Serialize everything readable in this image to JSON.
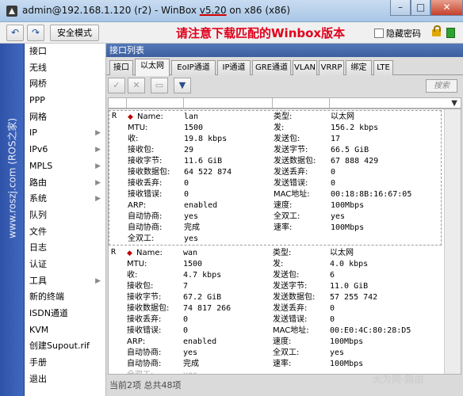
{
  "window": {
    "title_prefix": "admin@192.168.1.120 (r2) - WinBox ",
    "title_version": "v5.20",
    "title_suffix": " on x86 (x86)",
    "min_glyph": "–",
    "max_glyph": "□",
    "close_glyph": "✕"
  },
  "toolbar": {
    "undo_glyph": "↶",
    "redo_glyph": "↷",
    "safe_mode_label": "安全模式",
    "notice": "请注意下载匹配的Winbox版本",
    "hide_passwords_label": "隐藏密码"
  },
  "sidebar": {
    "brand": "www.roszj.com (ROS之家)",
    "items": [
      {
        "label": "接口",
        "arrow": ""
      },
      {
        "label": "无线",
        "arrow": ""
      },
      {
        "label": "网桥",
        "arrow": ""
      },
      {
        "label": "PPP",
        "arrow": ""
      },
      {
        "label": "网格",
        "arrow": ""
      },
      {
        "label": "IP",
        "arrow": "▶"
      },
      {
        "label": "IPv6",
        "arrow": "▶"
      },
      {
        "label": "MPLS",
        "arrow": "▶"
      },
      {
        "label": "路由",
        "arrow": "▶"
      },
      {
        "label": "系统",
        "arrow": "▶"
      },
      {
        "label": "队列",
        "arrow": ""
      },
      {
        "label": "文件",
        "arrow": ""
      },
      {
        "label": "日志",
        "arrow": ""
      },
      {
        "label": "认证",
        "arrow": ""
      },
      {
        "label": "工具",
        "arrow": "▶"
      },
      {
        "label": "新的终端",
        "arrow": ""
      },
      {
        "label": "ISDN通道",
        "arrow": ""
      },
      {
        "label": "KVM",
        "arrow": ""
      },
      {
        "label": "创建Supout.rif",
        "arrow": ""
      },
      {
        "label": "手册",
        "arrow": ""
      },
      {
        "label": "退出",
        "arrow": ""
      }
    ]
  },
  "panel": {
    "title": "接口列表",
    "tabs": [
      {
        "label": "接口"
      },
      {
        "label": "以太网"
      },
      {
        "label": "EoIP通道"
      },
      {
        "label": "IP通道"
      },
      {
        "label": "GRE通道"
      },
      {
        "label": "VLAN"
      },
      {
        "label": "VRRP"
      },
      {
        "label": "绑定"
      },
      {
        "label": "LTE"
      }
    ],
    "tools": {
      "enable": "✓",
      "disable": "✕",
      "comment": "▭",
      "filter": "▼"
    },
    "search_placeholder": "搜索",
    "status": "当前2项 总共48项"
  },
  "interfaces": [
    {
      "flag": "R",
      "rows": [
        [
          "Name:",
          "lan",
          "类型:",
          "以太网"
        ],
        [
          "MTU:",
          "1500",
          "发:",
          "156.2 kbps"
        ],
        [
          "收:",
          "19.8 kbps",
          "发送包:",
          "17"
        ],
        [
          "接收包:",
          "29",
          "发送字节:",
          "66.5 GiB"
        ],
        [
          "接收字节:",
          "11.6 GiB",
          "发送数据包:",
          "67 888 429"
        ],
        [
          "接收数据包:",
          "64 522 874",
          "发送丢弃:",
          "0"
        ],
        [
          "接收丢弃:",
          "0",
          "发送错误:",
          "0"
        ],
        [
          "接收错误:",
          "0",
          "MAC地址:",
          "00:18:8B:16:67:05"
        ],
        [
          "ARP:",
          "enabled",
          "速度:",
          "100Mbps"
        ],
        [
          "自动协商:",
          "yes",
          "全双工:",
          "yes"
        ],
        [
          "自动协商:",
          "完成",
          "速率:",
          "100Mbps"
        ],
        [
          "全双工:",
          "yes",
          "",
          ""
        ]
      ]
    },
    {
      "flag": "R",
      "rows": [
        [
          "Name:",
          "wan",
          "类型:",
          "以太网"
        ],
        [
          "MTU:",
          "1500",
          "发:",
          "4.0 kbps"
        ],
        [
          "收:",
          "4.7 kbps",
          "发送包:",
          "6"
        ],
        [
          "接收包:",
          "7",
          "发送字节:",
          "11.0 GiB"
        ],
        [
          "接收字节:",
          "67.2 GiB",
          "发送数据包:",
          "57 255 742"
        ],
        [
          "接收数据包:",
          "74 817 266",
          "发送丢弃:",
          "0"
        ],
        [
          "接收丢弃:",
          "0",
          "发送错误:",
          "0"
        ],
        [
          "接收错误:",
          "0",
          "MAC地址:",
          "00:E0:4C:80:28:D5"
        ],
        [
          "ARP:",
          "enabled",
          "速度:",
          "100Mbps"
        ],
        [
          "自动协商:",
          "yes",
          "全双工:",
          "yes"
        ],
        [
          "自动协商:",
          "完成",
          "速率:",
          "100Mbps"
        ],
        [
          "全双工:",
          "yes",
          "",
          ""
        ]
      ]
    }
  ],
  "watermark": "大为网·路由"
}
